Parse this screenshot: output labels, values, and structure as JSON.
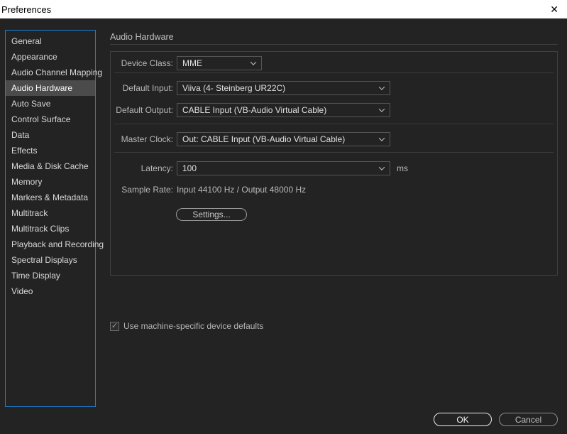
{
  "window": {
    "title": "Preferences",
    "close_icon": "✕"
  },
  "sidebar": {
    "selected": "Audio Hardware",
    "items": [
      {
        "label": "General"
      },
      {
        "label": "Appearance"
      },
      {
        "label": "Audio Channel Mapping"
      },
      {
        "label": "Audio Hardware"
      },
      {
        "label": "Auto Save"
      },
      {
        "label": "Control Surface"
      },
      {
        "label": "Data"
      },
      {
        "label": "Effects"
      },
      {
        "label": "Media & Disk Cache"
      },
      {
        "label": "Memory"
      },
      {
        "label": "Markers & Metadata"
      },
      {
        "label": "Multitrack"
      },
      {
        "label": "Multitrack Clips"
      },
      {
        "label": "Playback and Recording"
      },
      {
        "label": "Spectral Displays"
      },
      {
        "label": "Time Display"
      },
      {
        "label": "Video"
      }
    ]
  },
  "panel": {
    "title": "Audio Hardware"
  },
  "form": {
    "device_class": {
      "label": "Device Class:",
      "value": "MME"
    },
    "default_input": {
      "label": "Default Input:",
      "value": "Viiva (4- Steinberg UR22C)"
    },
    "default_output": {
      "label": "Default Output:",
      "value": "CABLE Input (VB-Audio Virtual Cable)"
    },
    "master_clock": {
      "label": "Master Clock:",
      "value": "Out: CABLE Input (VB-Audio Virtual Cable)"
    },
    "latency": {
      "label": "Latency:",
      "value": "100",
      "unit": "ms"
    },
    "sample_rate": {
      "label": "Sample Rate:",
      "value": "Input 44100 Hz / Output 48000 Hz"
    },
    "settings_button": "Settings..."
  },
  "checkbox": {
    "label": "Use machine-specific device defaults",
    "checked": true,
    "check_glyph": "✓"
  },
  "buttons": {
    "ok": "OK",
    "cancel": "Cancel"
  },
  "colors": {
    "titlebar_bg": "#ffffff",
    "body_bg": "#232323",
    "sidebar_focus_border": "#1b7fd4",
    "selection_bg": "#4b4b4b",
    "separator": "#3a3a3a"
  }
}
